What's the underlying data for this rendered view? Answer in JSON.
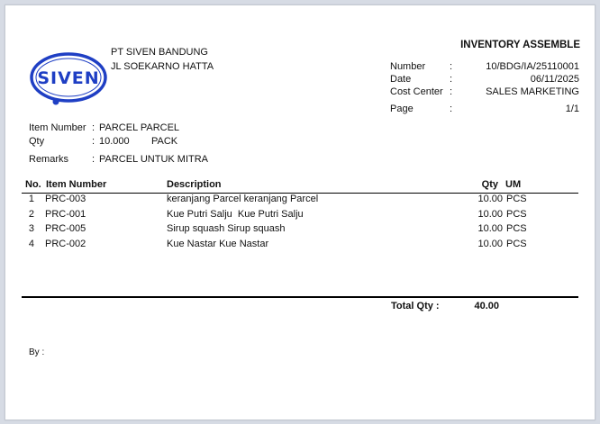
{
  "company": {
    "logo_text": "SIVEN",
    "name": "PT SIVEN BANDUNG",
    "address": "JL SOEKARNO HATTA"
  },
  "document": {
    "title": "INVENTORY ASSEMBLE",
    "fields": [
      {
        "label": "Number",
        "value": "10/BDG/IA/25110001"
      },
      {
        "label": "Date",
        "value": "06/11/2025"
      },
      {
        "label": "Cost Center",
        "value": "SALES MARKETING"
      },
      {
        "label": "Page",
        "value": "1/1"
      }
    ]
  },
  "assembly": {
    "item_number_label": "Item Number",
    "item_number": "PARCEL PARCEL",
    "qty_label": "Qty",
    "qty": "10.000",
    "qty_unit": "PACK",
    "remarks_label": "Remarks",
    "remarks": "PARCEL UNTUK MITRA"
  },
  "table": {
    "headers": {
      "no": "No.",
      "item_number": "Item Number",
      "description": "Description",
      "qty": "Qty",
      "um": "UM"
    },
    "rows": [
      {
        "no": "1",
        "item": "PRC-003",
        "desc": "keranjang Parcel keranjang Parcel",
        "qty": "10.00",
        "um": "PCS"
      },
      {
        "no": "2",
        "item": "PRC-001",
        "desc": "Kue Putri Salju  Kue Putri Salju",
        "qty": "10.00",
        "um": "PCS"
      },
      {
        "no": "3",
        "item": "PRC-005",
        "desc": "Sirup squash Sirup squash",
        "qty": "10.00",
        "um": "PCS"
      },
      {
        "no": "4",
        "item": "PRC-002",
        "desc": "Kue Nastar Kue Nastar",
        "qty": "10.00",
        "um": "PCS"
      }
    ]
  },
  "totals": {
    "label": "Total Qty :",
    "value": "40.00"
  },
  "footer": {
    "by_label": "By :"
  },
  "colors": {
    "logo_blue": "#1f3fc4",
    "page_bg": "#ffffff",
    "window_bg": "#d6dbe4"
  }
}
